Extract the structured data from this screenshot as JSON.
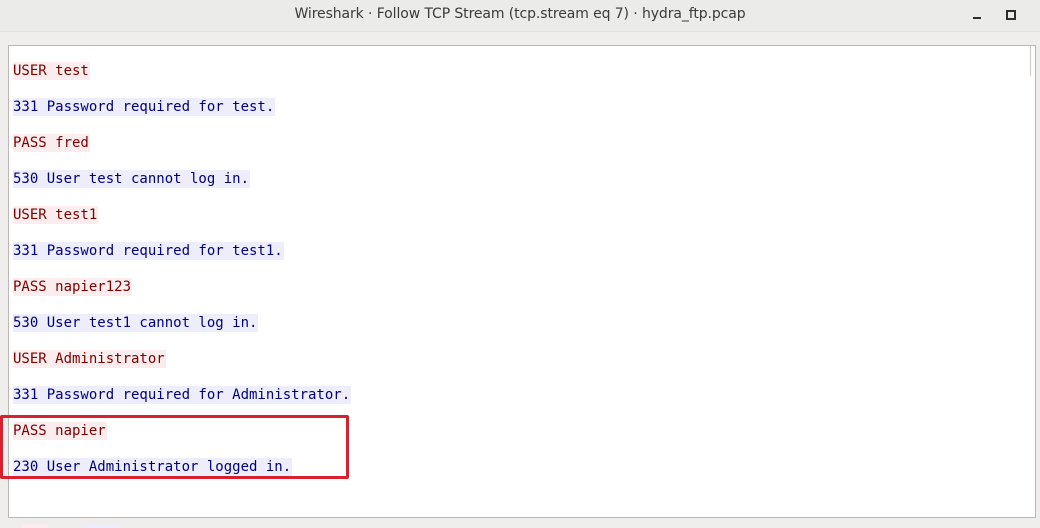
{
  "window": {
    "title": "Wireshark · Follow TCP Stream (tcp.stream eq 7) · hydra_ftp.pcap"
  },
  "colors": {
    "client_text": "#7f0000",
    "client_bg": "#fbeded",
    "server_text": "#00007f",
    "server_bg": "#ededfb",
    "annotation": "#d9202f"
  },
  "stream": {
    "lines": [
      {
        "dir": "client",
        "text": "USER test"
      },
      {
        "dir": "server",
        "text": "331 Password required for test."
      },
      {
        "dir": "client",
        "text": "PASS fred"
      },
      {
        "dir": "server",
        "text": "530 User test cannot log in."
      },
      {
        "dir": "client",
        "text": "USER test1"
      },
      {
        "dir": "server",
        "text": "331 Password required for test1."
      },
      {
        "dir": "client",
        "text": "PASS napier123"
      },
      {
        "dir": "server",
        "text": "530 User test1 cannot log in."
      },
      {
        "dir": "client",
        "text": "USER Administrator"
      },
      {
        "dir": "server",
        "text": "331 Password required for Administrator."
      },
      {
        "dir": "client",
        "text": "PASS napier"
      },
      {
        "dir": "server",
        "text": "230 User Administrator logged in."
      }
    ]
  }
}
